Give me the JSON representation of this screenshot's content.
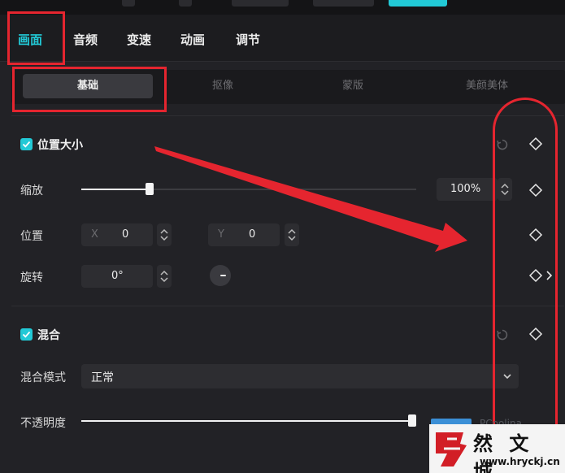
{
  "main_tabs": [
    "画面",
    "音频",
    "变速",
    "动画",
    "调节"
  ],
  "sub_tabs": [
    "基础",
    "抠像",
    "蒙版",
    "美颜美体"
  ],
  "position_size": {
    "title": "位置大小",
    "scale_label": "缩放",
    "scale_value": "100%",
    "position_label": "位置",
    "x_prefix": "X",
    "x_value": "0",
    "y_prefix": "Y",
    "y_value": "0",
    "rotate_label": "旋转",
    "rotate_value": "0°",
    "scale_level": 0.21
  },
  "blend": {
    "title": "混合",
    "mode_label": "混合模式",
    "mode_value": "正常",
    "opacity_label": "不透明度",
    "opacity_level": 1.0
  },
  "watermark": {
    "overlay_text": "PCoolina",
    "brand": "然 文 城",
    "url": "www.hryckj.cn"
  },
  "colors": {
    "accent": "#22c9d6",
    "annotation_red": "#e5252f",
    "panel_bg": "#222226"
  }
}
